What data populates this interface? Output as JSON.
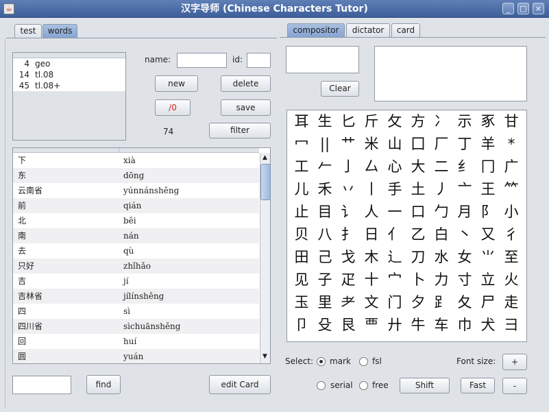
{
  "window": {
    "title": "汉字导师 (Chinese Characters Tutor)",
    "app_icon_glyph": "☕",
    "minimize_glyph": "_",
    "maximize_glyph": "□",
    "close_glyph": "×"
  },
  "left_tabs": [
    "test",
    "words"
  ],
  "right_tabs": [
    "compositor",
    "dictator",
    "card"
  ],
  "lists": [
    {
      "count": "4",
      "name": "geo"
    },
    {
      "count": "14",
      "name": "tl.08"
    },
    {
      "count": "45",
      "name": "tl.08+"
    }
  ],
  "form": {
    "name_label": "name:",
    "name_value": "",
    "id_label": "id:",
    "id_value": "",
    "new_label": "new",
    "delete_label": "delete",
    "ratio_label": "/0",
    "save_label": "save",
    "total_count": "74",
    "filter_label": "filter"
  },
  "words": [
    {
      "hanzi": "下",
      "pinyin": "xià"
    },
    {
      "hanzi": "东",
      "pinyin": "dōng"
    },
    {
      "hanzi": "云南省",
      "pinyin": "yúnnánshěng"
    },
    {
      "hanzi": "前",
      "pinyin": "qián"
    },
    {
      "hanzi": "北",
      "pinyin": "běi"
    },
    {
      "hanzi": "南",
      "pinyin": "nán"
    },
    {
      "hanzi": "去",
      "pinyin": "qù"
    },
    {
      "hanzi": "只好",
      "pinyin": "zhǐhǎo"
    },
    {
      "hanzi": "吉",
      "pinyin": "jí"
    },
    {
      "hanzi": "吉林省",
      "pinyin": "jílínshěng"
    },
    {
      "hanzi": "四",
      "pinyin": "sì"
    },
    {
      "hanzi": "四川省",
      "pinyin": "sìchuānshěng"
    },
    {
      "hanzi": "回",
      "pinyin": "huí"
    },
    {
      "hanzi": "圆",
      "pinyin": "yuán"
    }
  ],
  "bottom_left": {
    "find_value": "",
    "find_label": "find",
    "edit_card_label": "edit Card"
  },
  "compositor": {
    "input_value": "",
    "clear_label": "Clear",
    "components": [
      [
        "耳",
        "生",
        "匕",
        "斤",
        "攵",
        "方",
        "冫",
        "示",
        "豖",
        "甘"
      ],
      [
        "冖",
        "||",
        "艹",
        "米",
        "山",
        "囗",
        "厂",
        "丁",
        "羊",
        "*"
      ],
      [
        "工",
        "𠂉",
        "亅",
        "厶",
        "心",
        "大",
        "二",
        "纟",
        "冂",
        "广"
      ],
      [
        "儿",
        "禾",
        "丷",
        "丨",
        "手",
        "土",
        "丿",
        "亠",
        "王",
        "⺮"
      ],
      [
        "止",
        "目",
        "讠",
        "人",
        "一",
        "口",
        "勹",
        "月",
        "阝",
        "小"
      ],
      [
        "贝",
        "八",
        "扌",
        "日",
        "亻",
        "乙",
        "白",
        "丶",
        "又",
        "彳"
      ],
      [
        "田",
        "己",
        "戈",
        "木",
        "辶",
        "刀",
        "水",
        "女",
        "⺌",
        "至"
      ],
      [
        "见",
        "子",
        "疋",
        "十",
        "宀",
        "卜",
        "力",
        "寸",
        "立",
        "火"
      ],
      [
        "玉",
        "里",
        "耂",
        "文",
        "门",
        "夕",
        "⻊",
        "夂",
        "尸",
        "走"
      ],
      [
        "卩",
        "殳",
        "艮",
        "覀",
        "廾",
        "牛",
        "车",
        "巾",
        "犬",
        "彐"
      ]
    ]
  },
  "controls": {
    "select_label": "Select:",
    "mark_label": "mark",
    "mark_selected": true,
    "fsl_label": "fsl",
    "fsl_selected": false,
    "serial_label": "serial",
    "serial_selected": false,
    "free_label": "free",
    "free_selected": false,
    "shift_label": "Shift",
    "font_size_label": "Font size:",
    "plus_label": "+",
    "fast_label": "Fast",
    "minus_label": "-"
  },
  "colors": {
    "titlebar": "#4a6ca6",
    "active_tab": "#96b2db",
    "ratio_red": "#d42020"
  }
}
